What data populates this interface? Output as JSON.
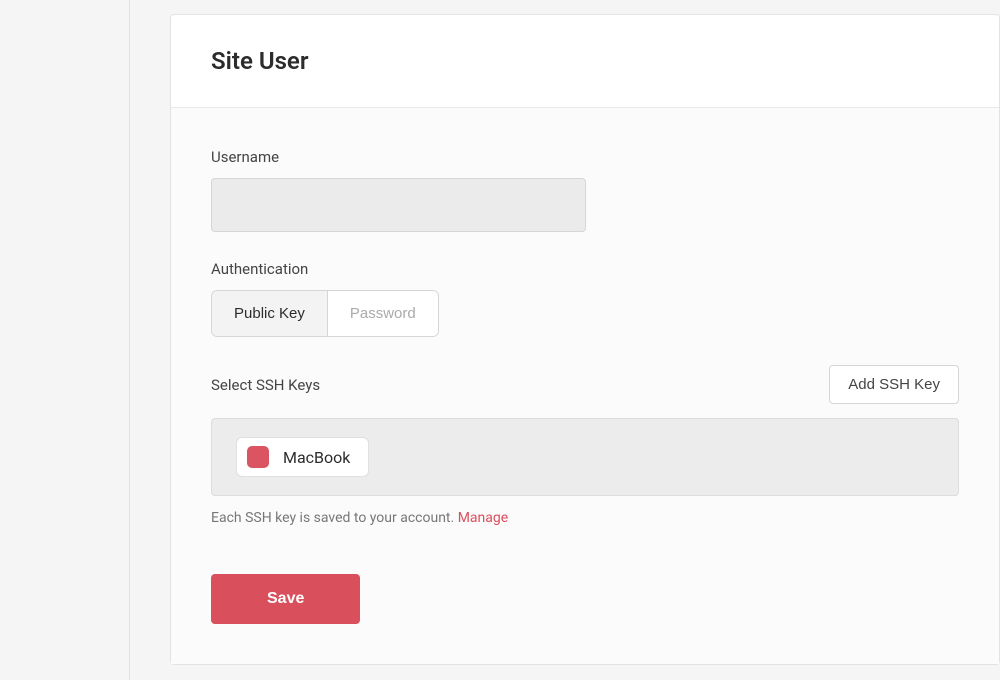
{
  "card": {
    "title": "Site User"
  },
  "username": {
    "label": "Username",
    "value": ""
  },
  "authentication": {
    "label": "Authentication",
    "options": {
      "public_key": "Public Key",
      "password": "Password"
    }
  },
  "ssh": {
    "label": "Select SSH Keys",
    "add_button": "Add SSH Key",
    "keys": [
      {
        "label": "MacBook"
      }
    ],
    "helper_text": "Each SSH key is saved to your account. ",
    "manage_link": "Manage"
  },
  "actions": {
    "save": "Save"
  }
}
